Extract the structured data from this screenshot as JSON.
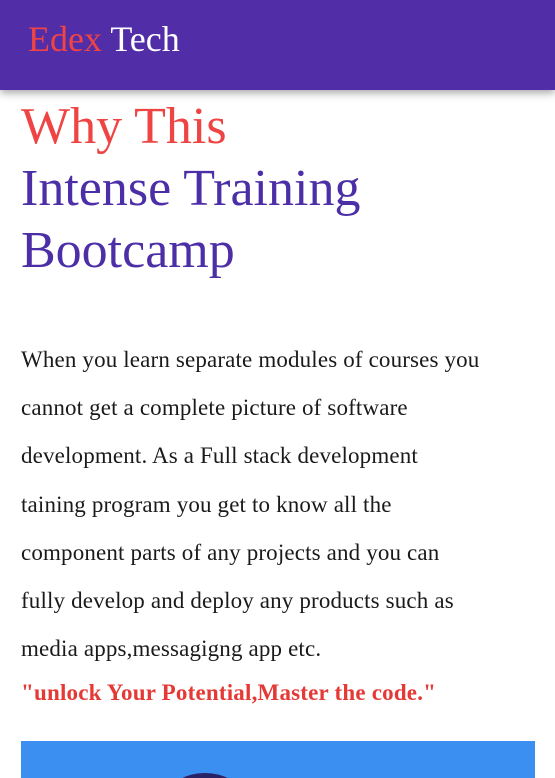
{
  "navbar": {
    "brand_part1": "Edex",
    "brand_part2": "Tech"
  },
  "hero": {
    "heading_lines": [
      "Why This",
      "Intense Training",
      "Bootcamp"
    ],
    "paragraph_lines": [
      "When you learn separate modules of courses you",
      "cannot get a complete picture of software",
      "development. As a Full stack development",
      "taining program you get to know all the",
      "component parts of any projects and you can",
      "fully develop and deploy any products such as",
      "media apps,messagigng app etc."
    ],
    "tagline": "\"unlock Your Potential,Master the code.\""
  },
  "colors": {
    "navbar_bg": "#512da8",
    "accent_red": "#ef4444",
    "heading_purple": "#4c2fa7",
    "banner_blue": "#3b8ff0"
  }
}
